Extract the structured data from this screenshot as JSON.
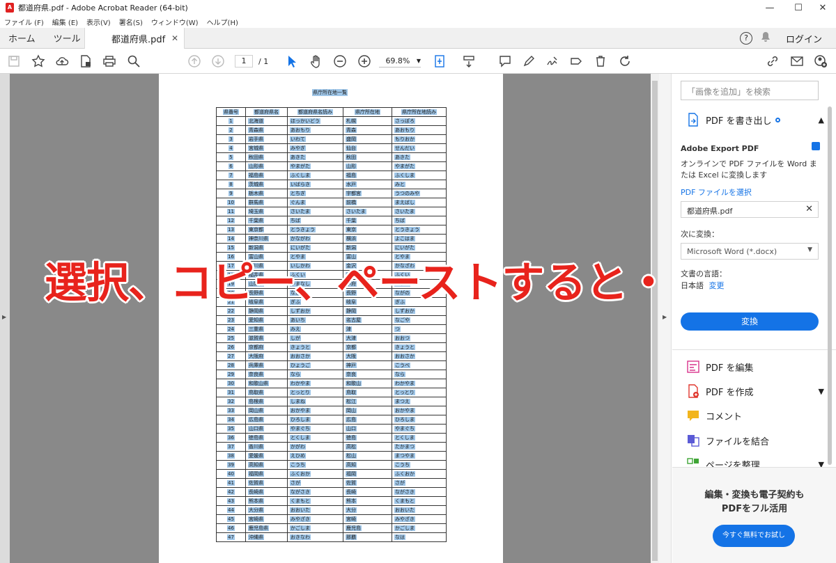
{
  "window": {
    "title": "都道府県.pdf - Adobe Acrobat Reader (64-bit)",
    "controls": [
      "—",
      "☐",
      "✕"
    ]
  },
  "menu": [
    "ファイル (F)",
    "編集 (E)",
    "表示(V)",
    "署名(S)",
    "ウィンドウ(W)",
    "ヘルプ(H)"
  ],
  "tabs": {
    "home": "ホーム",
    "tools": "ツール",
    "document": "都道府県.pdf",
    "login": "ログイン"
  },
  "toolbar": {
    "page_current": "1",
    "page_total": "/ 1",
    "zoom": "69.8%"
  },
  "document": {
    "title": "県庁所在地一覧",
    "headers": [
      "県番号",
      "都道府県名",
      "都道府県名読み",
      "県庁所在地",
      "県庁所在地読み"
    ],
    "rows": [
      [
        "1",
        "北海道",
        "ほっかいどう",
        "札幌",
        "さっぽろ"
      ],
      [
        "2",
        "青森県",
        "あおもり",
        "青森",
        "あおもり"
      ],
      [
        "3",
        "岩手県",
        "いわて",
        "盛岡",
        "もりおか"
      ],
      [
        "4",
        "宮城県",
        "みやぎ",
        "仙台",
        "せんだい"
      ],
      [
        "5",
        "秋田県",
        "あきた",
        "秋田",
        "あきた"
      ],
      [
        "6",
        "山形県",
        "やまがた",
        "山形",
        "やまがた"
      ],
      [
        "7",
        "福島県",
        "ふくしま",
        "福島",
        "ふくしま"
      ],
      [
        "8",
        "茨城県",
        "いばらき",
        "水戸",
        "みと"
      ],
      [
        "9",
        "栃木県",
        "とちぎ",
        "宇都宮",
        "うつのみや"
      ],
      [
        "10",
        "群馬県",
        "ぐんま",
        "前橋",
        "まえばし"
      ],
      [
        "11",
        "埼玉県",
        "さいたま",
        "さいたま",
        "さいたま"
      ],
      [
        "12",
        "千葉県",
        "ちば",
        "千葉",
        "ちば"
      ],
      [
        "13",
        "東京都",
        "とうきょう",
        "東京",
        "とうきょう"
      ],
      [
        "14",
        "神奈川県",
        "かながわ",
        "横浜",
        "よこはま"
      ],
      [
        "15",
        "新潟県",
        "にいがた",
        "新潟",
        "にいがた"
      ],
      [
        "16",
        "富山県",
        "とやま",
        "富山",
        "とやま"
      ],
      [
        "17",
        "石川県",
        "いしかわ",
        "金沢",
        "かなざわ"
      ],
      [
        "18",
        "福井県",
        "ふくい",
        "福井",
        "ふくい"
      ],
      [
        "19",
        "山梨県",
        "やまなし",
        "甲府",
        "こうふ"
      ],
      [
        "20",
        "長野県",
        "ながの",
        "長野",
        "ながの"
      ],
      [
        "21",
        "岐阜県",
        "ぎふ",
        "岐阜",
        "ぎふ"
      ],
      [
        "22",
        "静岡県",
        "しずおか",
        "静岡",
        "しずおか"
      ],
      [
        "23",
        "愛知県",
        "あいち",
        "名古屋",
        "なごや"
      ],
      [
        "24",
        "三重県",
        "みえ",
        "津",
        "つ"
      ],
      [
        "25",
        "滋賀県",
        "しが",
        "大津",
        "おおつ"
      ],
      [
        "26",
        "京都府",
        "きょうと",
        "京都",
        "きょうと"
      ],
      [
        "27",
        "大阪府",
        "おおさか",
        "大阪",
        "おおさか"
      ],
      [
        "28",
        "兵庫県",
        "ひょうご",
        "神戸",
        "こうべ"
      ],
      [
        "29",
        "奈良県",
        "なら",
        "奈良",
        "なら"
      ],
      [
        "30",
        "和歌山県",
        "わかやま",
        "和歌山",
        "わかやま"
      ],
      [
        "31",
        "鳥取県",
        "とっとり",
        "鳥取",
        "とっとり"
      ],
      [
        "32",
        "島根県",
        "しまね",
        "松江",
        "まつえ"
      ],
      [
        "33",
        "岡山県",
        "おかやま",
        "岡山",
        "おかやま"
      ],
      [
        "34",
        "広島県",
        "ひろしま",
        "広島",
        "ひろしま"
      ],
      [
        "35",
        "山口県",
        "やまぐち",
        "山口",
        "やまぐち"
      ],
      [
        "36",
        "徳島県",
        "とくしま",
        "徳島",
        "とくしま"
      ],
      [
        "37",
        "香川県",
        "かがわ",
        "高松",
        "たかまつ"
      ],
      [
        "38",
        "愛媛県",
        "えひめ",
        "松山",
        "まつやま"
      ],
      [
        "39",
        "高知県",
        "こうち",
        "高知",
        "こうち"
      ],
      [
        "40",
        "福岡県",
        "ふくおか",
        "福岡",
        "ふくおか"
      ],
      [
        "41",
        "佐賀県",
        "さが",
        "佐賀",
        "さが"
      ],
      [
        "42",
        "長崎県",
        "ながさき",
        "長崎",
        "ながさき"
      ],
      [
        "43",
        "熊本県",
        "くまもと",
        "熊本",
        "くまもと"
      ],
      [
        "44",
        "大分県",
        "おおいた",
        "大分",
        "おおいた"
      ],
      [
        "45",
        "宮崎県",
        "みやざき",
        "宮崎",
        "みやざき"
      ],
      [
        "46",
        "鹿児島県",
        "かごしま",
        "鹿児島",
        "かごしま"
      ],
      [
        "47",
        "沖縄県",
        "おきなわ",
        "那覇",
        "なは"
      ]
    ]
  },
  "overlay_text": "選択、コピー、ペーストすると・・・",
  "right_panel": {
    "search_placeholder": "「画像を追加」を検索",
    "export_title": "PDF を書き出し",
    "export_heading": "Adobe Export PDF",
    "export_desc": "オンラインで PDF ファイルを Word または Excel に変換します",
    "select_file": "PDF ファイルを選択",
    "file_name": "都道府県.pdf",
    "convert_to_label": "次に変換：",
    "convert_to_value": "Microsoft Word (*.docx)",
    "doc_lang_label": "文書の言語：",
    "doc_lang_value": "日本語",
    "doc_lang_change": "変更",
    "convert_button": "変換",
    "tools": [
      "PDF を編集",
      "PDF を作成",
      "コメント",
      "ファイルを結合",
      "ページを整理"
    ],
    "promo_line1": "編集・変換も電子契約も",
    "promo_line2": "PDFをフル活用",
    "promo_button": "今すぐ無料でお試し"
  },
  "colors": {
    "selection": "#9fc6e8",
    "accent": "#1473e6",
    "overlay": "#e8231c",
    "doc_background": "#898989"
  }
}
